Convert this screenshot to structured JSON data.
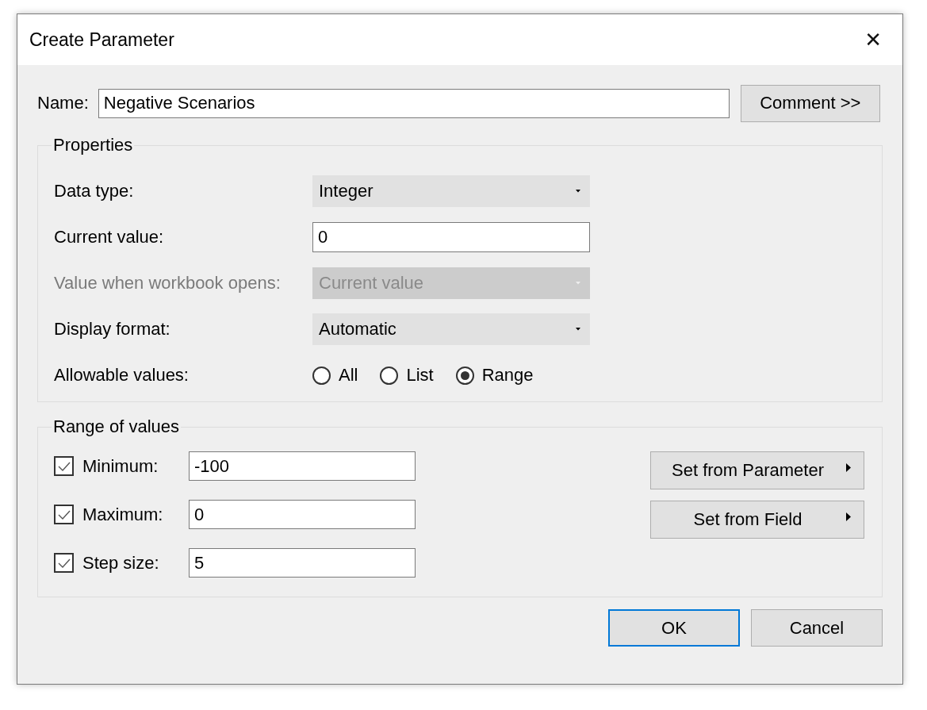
{
  "window": {
    "title": "Create Parameter",
    "close": "✕"
  },
  "name": {
    "label": "Name:",
    "value": "Negative Scenarios"
  },
  "comment_button": "Comment >>",
  "properties": {
    "legend": "Properties",
    "rows": [
      {
        "kind": "dropdown",
        "label": "Data type:",
        "value": "Integer",
        "disabled": false
      },
      {
        "kind": "input",
        "label": "Current value:",
        "value": "0"
      },
      {
        "kind": "dropdown",
        "label": "Value when workbook opens:",
        "value": "Current value",
        "disabled": true
      },
      {
        "kind": "dropdown",
        "label": "Display format:",
        "value": "Automatic",
        "disabled": false
      },
      {
        "kind": "radios",
        "label": "Allowable values:",
        "options": [
          {
            "label": "All",
            "selected": false
          },
          {
            "label": "List",
            "selected": false
          },
          {
            "label": "Range",
            "selected": true
          }
        ]
      }
    ]
  },
  "range": {
    "legend": "Range of values",
    "rows": [
      {
        "label": "Minimum:",
        "checked": true,
        "value": "-100"
      },
      {
        "label": "Maximum:",
        "checked": true,
        "value": "0"
      },
      {
        "label": "Step size:",
        "checked": true,
        "value": "5"
      }
    ],
    "buttons": [
      "Set from Parameter",
      "Set from Field"
    ]
  },
  "buttons": [
    {
      "label": "OK",
      "default": true
    },
    {
      "label": "Cancel",
      "default": false
    }
  ]
}
